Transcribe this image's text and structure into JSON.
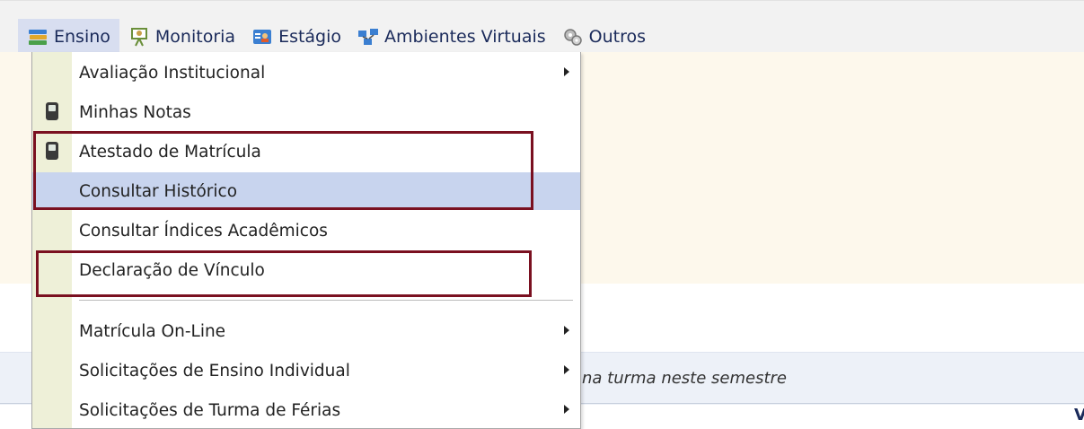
{
  "menubar": {
    "items": [
      {
        "label": "Ensino",
        "icon": "books-icon"
      },
      {
        "label": "Monitoria",
        "icon": "presenter-icon"
      },
      {
        "label": "Estágio",
        "icon": "id-card-icon"
      },
      {
        "label": "Ambientes Virtuais",
        "icon": "network-icon"
      },
      {
        "label": "Outros",
        "icon": "gears-icon"
      }
    ]
  },
  "dropdown": {
    "items": [
      {
        "label": "Avaliação Institucional",
        "submenu": true
      },
      {
        "label": "Minhas Notas",
        "icon": "mobile-icon"
      },
      {
        "label": "Atestado de Matrícula",
        "icon": "mobile-icon"
      },
      {
        "label": "Consultar Histórico",
        "highlighted": true
      },
      {
        "label": "Consultar Índices Acadêmicos"
      },
      {
        "label": "Declaração de Vínculo"
      },
      {
        "label": "Matrícula On-Line",
        "submenu": true
      },
      {
        "label": "Solicitações de Ensino Individual",
        "submenu": true
      },
      {
        "label": "Solicitações de Turma de Férias",
        "submenu": true
      }
    ]
  },
  "content": {
    "info_text": "na turma neste semestre",
    "edge_text": "V"
  },
  "colors": {
    "highlight": "#c8d4ee",
    "annotation_box": "#7a1020",
    "menu_text": "#1a2a5a"
  }
}
